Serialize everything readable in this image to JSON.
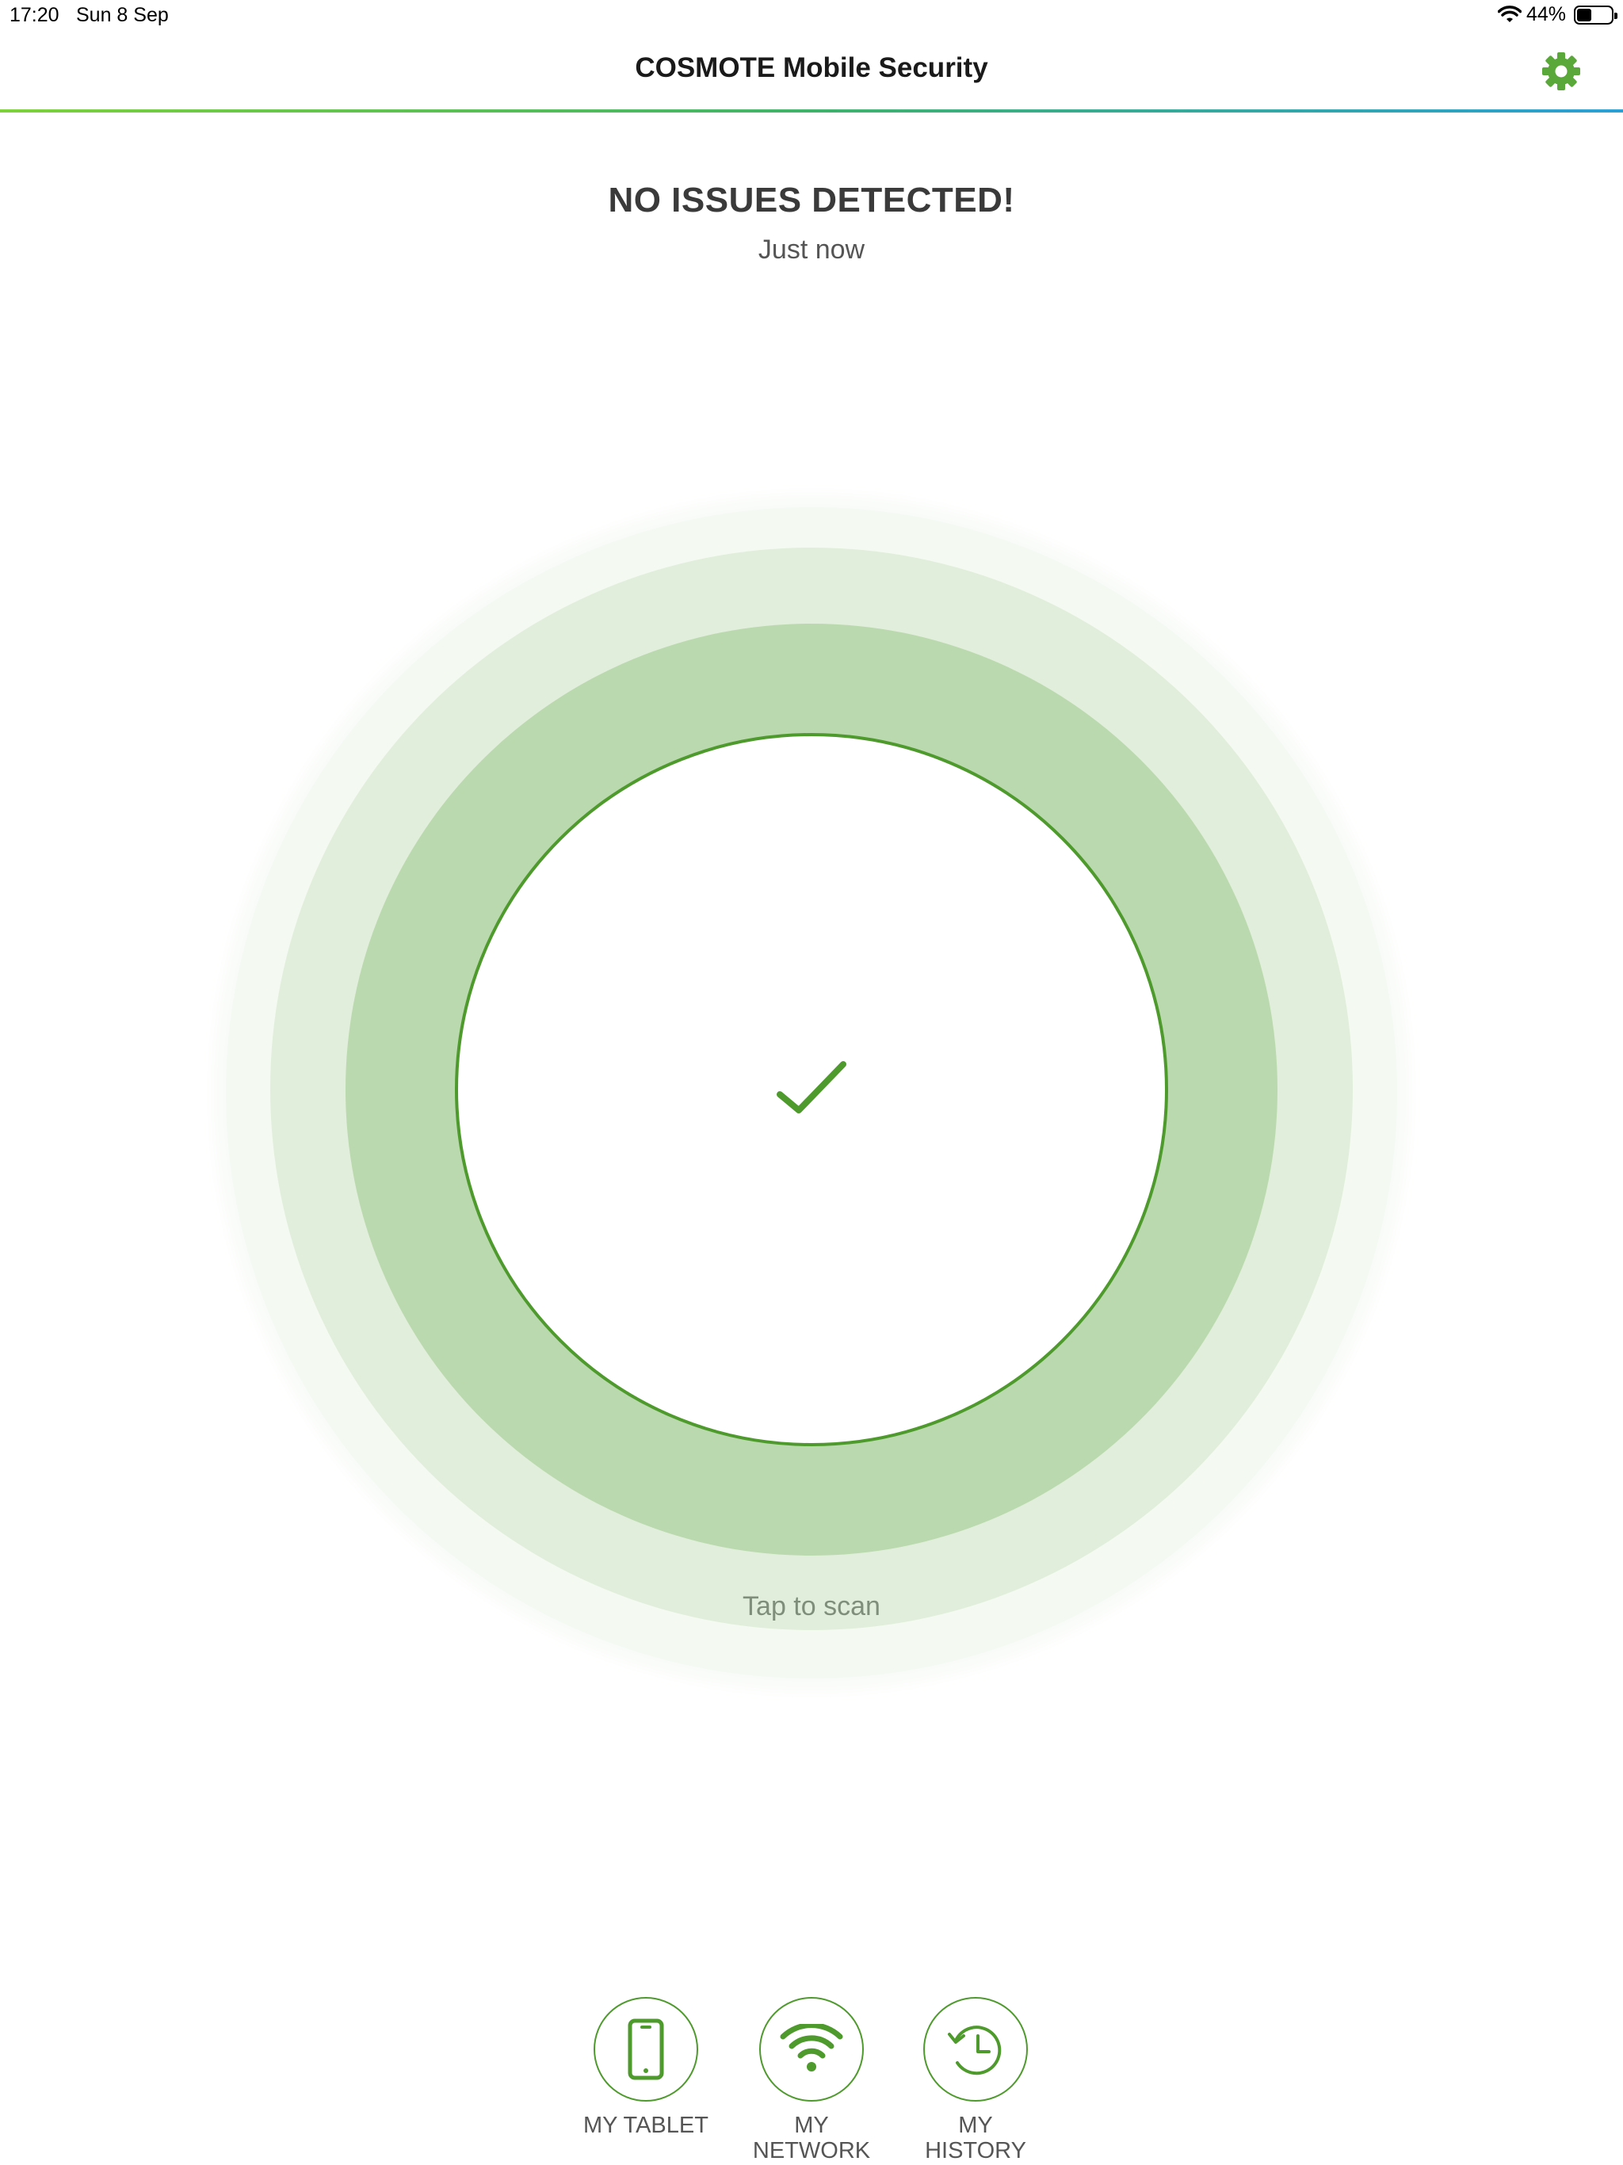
{
  "status_bar": {
    "time": "17:20",
    "date": "Sun 8 Sep",
    "battery": "44%",
    "battery_level": 0.44
  },
  "header": {
    "title": "COSMOTE Mobile Security",
    "settings_icon": "gear-icon"
  },
  "scan": {
    "status": "NO ISSUES DETECTED!",
    "time": "Just now",
    "tap_label": "Tap to scan",
    "result_icon": "checkmark-icon"
  },
  "colors": {
    "accent": "#4e9a2d",
    "ring_light": "#e1eedb",
    "ring_mid": "#bad9ae"
  },
  "nav": {
    "items": [
      {
        "label_line1": "MY TABLET",
        "label_line2": "",
        "icon": "tablet-icon"
      },
      {
        "label_line1": "MY",
        "label_line2": "NETWORK",
        "icon": "wifi-icon"
      },
      {
        "label_line1": "MY",
        "label_line2": "HISTORY",
        "icon": "history-icon"
      }
    ]
  }
}
